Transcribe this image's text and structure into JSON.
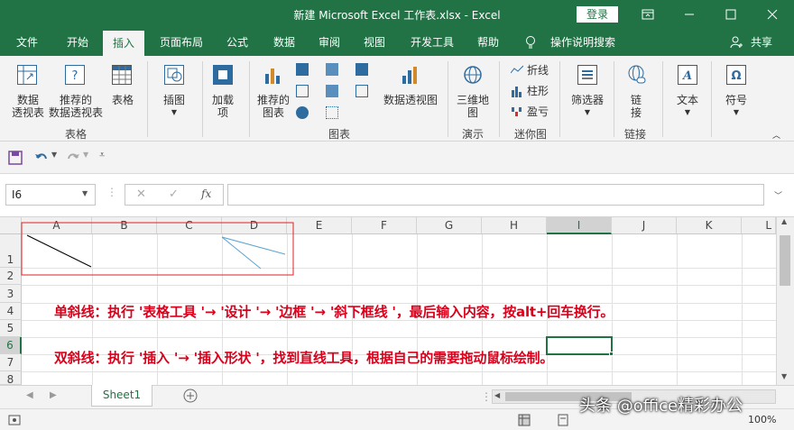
{
  "window": {
    "title": "新建 Microsoft Excel 工作表.xlsx  -  Excel",
    "login": "登录"
  },
  "tabs": [
    "文件",
    "开始",
    "插入",
    "页面布局",
    "公式",
    "数据",
    "审阅",
    "视图",
    "开发工具",
    "帮助"
  ],
  "tell_me": "操作说明搜索",
  "share": "共享",
  "ribbon": {
    "pivot": "数据\n透视表",
    "rec_pivot": "推荐的\n数据透视表",
    "table": "表格",
    "g_table": "表格",
    "illus": "插图",
    "addin": "加载\n项",
    "rec_chart": "推荐的\n图表",
    "pivot_chart": "数据透视图",
    "g_chart": "图表",
    "map3d": "三维地\n图",
    "g_tour": "演示",
    "spark_line": "折线",
    "spark_col": "柱形",
    "spark_wl": "盈亏",
    "g_spark": "迷你图",
    "filter": "筛选器",
    "link": "链\n接",
    "g_link": "链接",
    "text": "文本",
    "symbol": "符号"
  },
  "formula": {
    "namebox": "I6",
    "fx": "fx",
    "value": ""
  },
  "columns": [
    "A",
    "B",
    "C",
    "D",
    "E",
    "F",
    "G",
    "H",
    "I",
    "J",
    "K",
    "L"
  ],
  "rows": [
    "1",
    "2",
    "3",
    "4",
    "5",
    "6",
    "7",
    "8"
  ],
  "notes": [
    "单斜线：执行 '表格工具 '→ '设计 '→ '边框 '→ '斜下框线 '，最后输入内容，按alt+回车换行。",
    "双斜线：执行 '插入 '→ '插入形状 '，找到直线工具，根据自己的需要拖动鼠标绘制。"
  ],
  "sheet": "Sheet1",
  "status": {
    "zoom": "100%"
  },
  "watermark": "头条 @office精彩办公",
  "colors": {
    "excel_green": "#217346",
    "note_red": "#d9001b",
    "box_red": "#e02020"
  }
}
